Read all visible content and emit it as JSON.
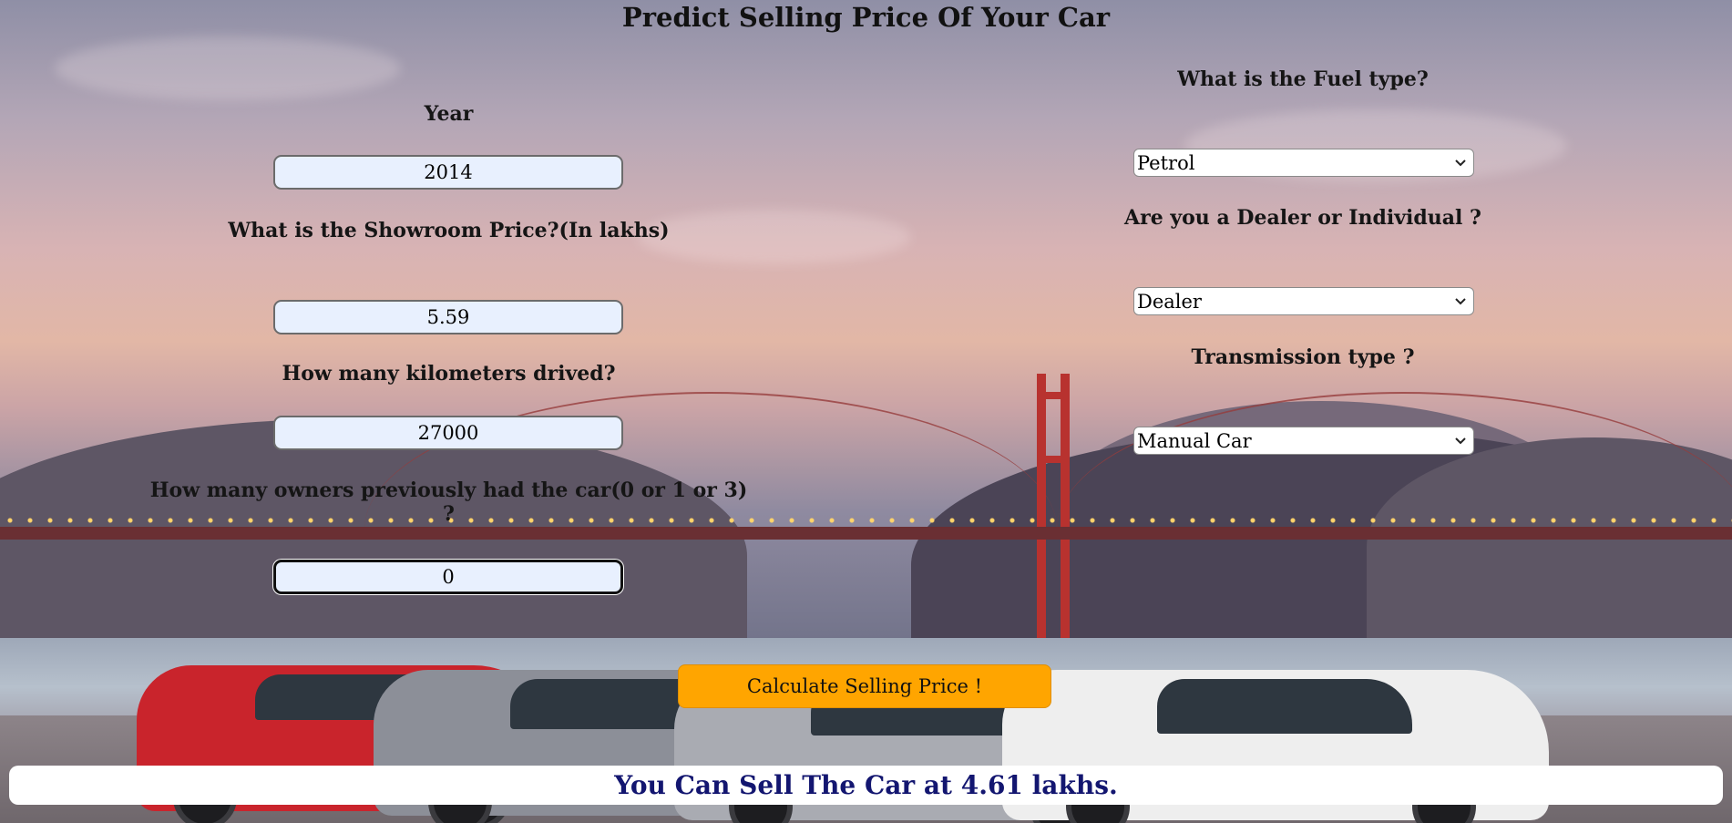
{
  "header": {
    "title": "Predict Selling Price Of Your Car"
  },
  "form_left": {
    "year": {
      "label": "Year",
      "value": "2014"
    },
    "showroom_price": {
      "label": "What is the Showroom Price?(In lakhs)",
      "value": "5.59"
    },
    "kms_driven": {
      "label": "How many kilometers drived?",
      "value": "27000"
    },
    "owners": {
      "label": "How many owners previously had the car(0 or 1 or 3) ?",
      "value": "0"
    }
  },
  "form_right": {
    "fuel_type": {
      "label": "What is the Fuel type?",
      "selected": "Petrol"
    },
    "seller_type": {
      "label": "Are you a Dealer or Individual ?",
      "selected": "Dealer"
    },
    "transmission": {
      "label": "Transmission type ?",
      "selected": "Manual Car"
    }
  },
  "actions": {
    "calculate_label": "Calculate Selling Price !"
  },
  "result": {
    "text": "You Can Sell The Car at 4.61 lakhs."
  },
  "colors": {
    "button": "#ffa500",
    "result_text": "#131670",
    "input_bg": "#e8f0fe"
  },
  "icons": {
    "select_chevron": "chevron-down-icon"
  }
}
